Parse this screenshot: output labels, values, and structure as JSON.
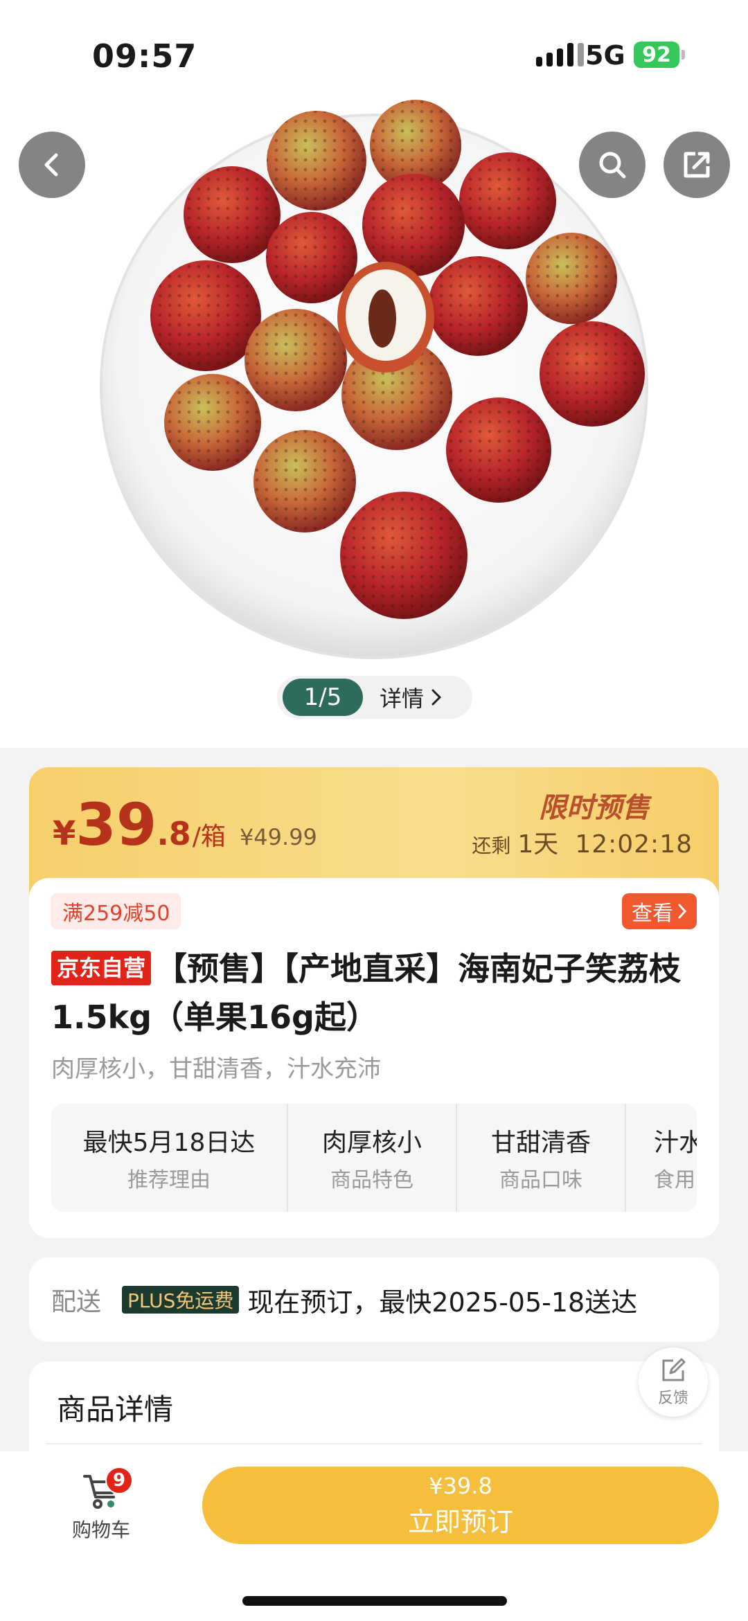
{
  "status_bar": {
    "time": "09:57",
    "network": "5G",
    "battery": "92"
  },
  "hero": {
    "pager_count": "1/5",
    "detail_label": "详情"
  },
  "price": {
    "yen": "¥",
    "integer": "39",
    "decimal": ".8",
    "unit": "/箱",
    "original": "¥49.99",
    "presale_label": "限时预售",
    "countdown_label": "还剩",
    "countdown_days": "1天",
    "countdown_time": "12:02:18"
  },
  "product": {
    "coupon": "满259减50",
    "look_label": "查看",
    "badge": "京东自营",
    "title": "【预售】【产地直采】海南妃子笑荔枝1.5kg（单果16g起）",
    "subtitle": "肉厚核小，甘甜清香，汁水充沛",
    "features": [
      {
        "main": "最快5月18日达",
        "sub": "推荐理由"
      },
      {
        "main": "肉厚核小",
        "sub": "商品特色"
      },
      {
        "main": "甘甜清香",
        "sub": "商品口味"
      },
      {
        "main": "汁水",
        "sub": "食用"
      }
    ]
  },
  "delivery": {
    "label": "配送",
    "plus_badge": "PLUS免运费",
    "text": "现在预订，最快2025-05-18送达"
  },
  "details": {
    "title": "商品详情"
  },
  "feedback": {
    "label": "反馈"
  },
  "bottom_bar": {
    "cart_label": "购物车",
    "cart_count": "9",
    "buy_price": "¥39.8",
    "buy_label": "立即预订"
  },
  "colors": {
    "brand_red": "#e2231a",
    "accent_yellow": "#f5be3c",
    "pager_green": "#2f6b5d"
  }
}
